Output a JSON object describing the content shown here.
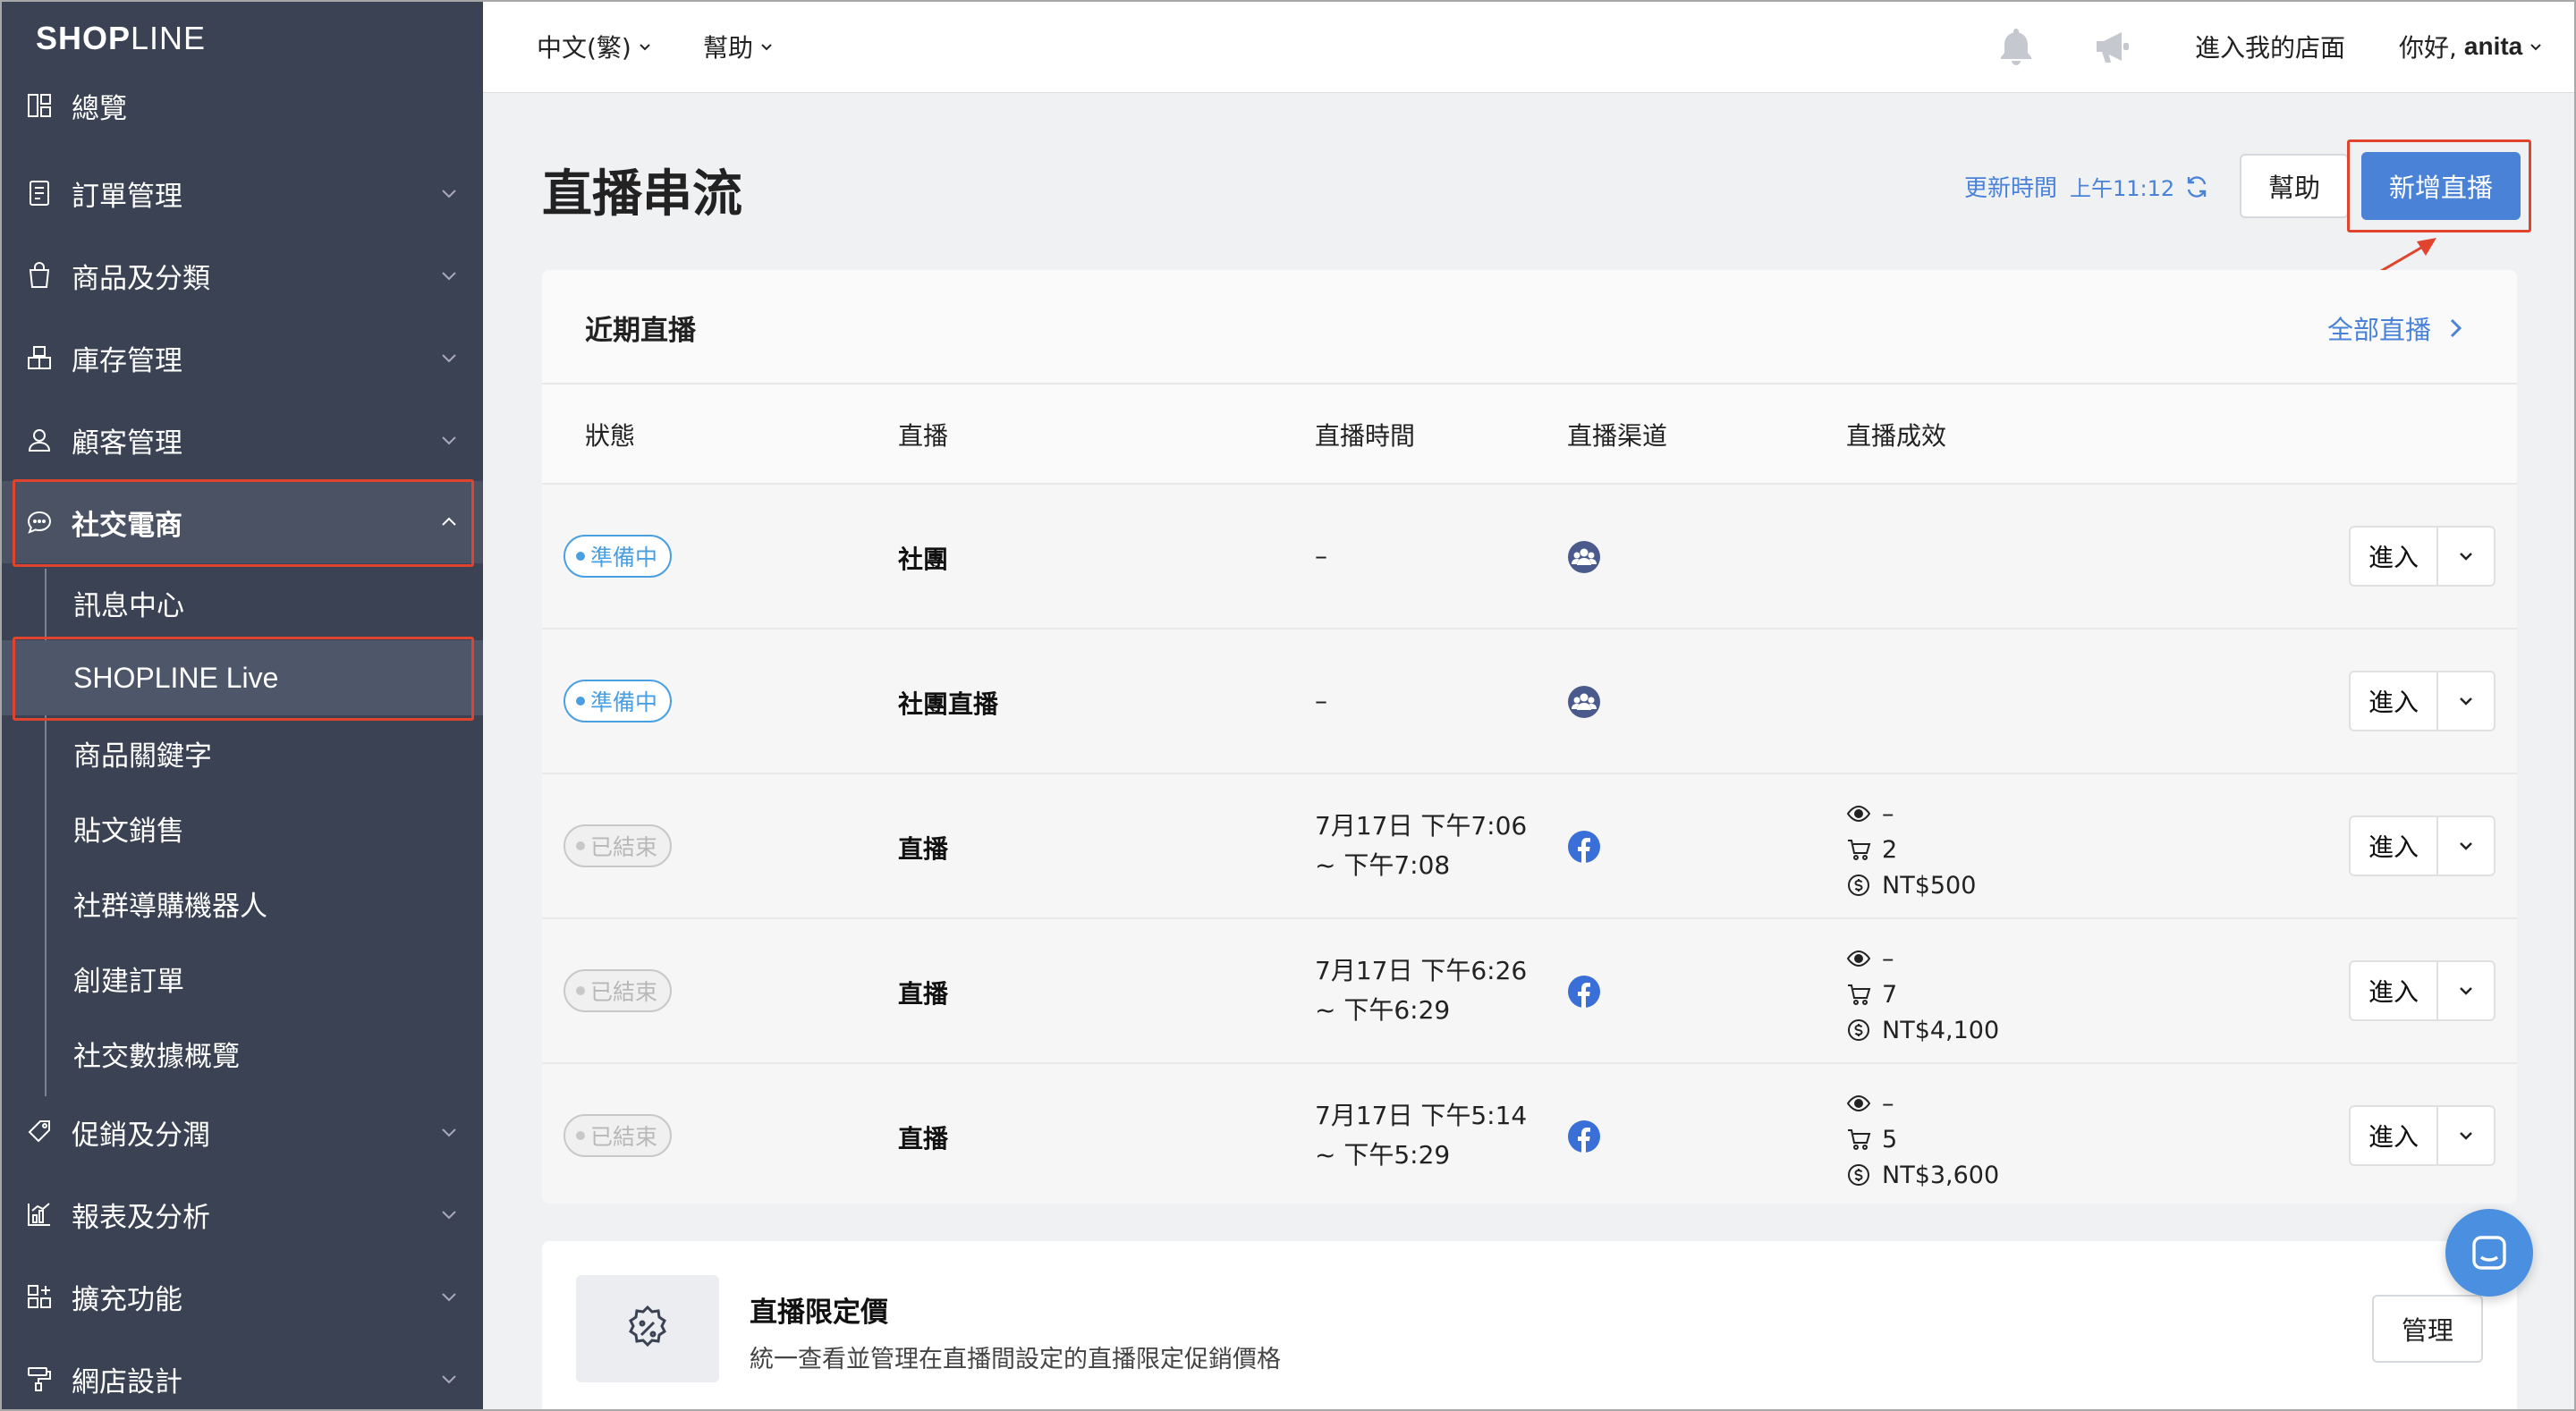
{
  "brand": {
    "logo_text_bold": "SHOP",
    "logo_text_thin": "LINE"
  },
  "sidebar": {
    "items": [
      {
        "label": "總覽",
        "icon": "dashboard-icon"
      },
      {
        "label": "訂單管理",
        "icon": "order-icon"
      },
      {
        "label": "商品及分類",
        "icon": "shopping-bag-icon"
      },
      {
        "label": "庫存管理",
        "icon": "inventory-icon"
      },
      {
        "label": "顧客管理",
        "icon": "user-icon"
      },
      {
        "label": "社交電商",
        "icon": "chat-bubble-icon"
      },
      {
        "label": "促銷及分潤",
        "icon": "tag-icon"
      },
      {
        "label": "報表及分析",
        "icon": "chart-icon"
      },
      {
        "label": "擴充功能",
        "icon": "apps-icon"
      },
      {
        "label": "網店設計",
        "icon": "paint-roller-icon"
      }
    ],
    "sub_items": [
      {
        "label": "訊息中心"
      },
      {
        "label": "SHOPLINE Live"
      },
      {
        "label": "商品關鍵字"
      },
      {
        "label": "貼文銷售"
      },
      {
        "label": "社群導購機器人"
      },
      {
        "label": "創建訂單"
      },
      {
        "label": "社交數據概覽"
      }
    ]
  },
  "topbar": {
    "language": "中文(繁)",
    "help": "幫助",
    "store_link": "進入我的店面",
    "greeting": "你好,",
    "username": "anita"
  },
  "page": {
    "title": "直播串流",
    "update_label": "更新時間",
    "update_time": "上午11:12",
    "help_button": "幫助",
    "new_live_button": "新增直播"
  },
  "recent": {
    "title": "近期直播",
    "all_link": "全部直播",
    "columns": [
      "狀態",
      "直播",
      "直播時間",
      "直播渠道",
      "直播成效"
    ],
    "enter_label": "進入",
    "rows": [
      {
        "status": "準備中",
        "status_type": "prep",
        "name": "社團",
        "time1": "–",
        "time2": "",
        "channel": "group-icon",
        "views": "",
        "orders": "",
        "revenue": ""
      },
      {
        "status": "準備中",
        "status_type": "prep",
        "name": "社團直播",
        "time1": "–",
        "time2": "",
        "channel": "group-icon",
        "views": "",
        "orders": "",
        "revenue": ""
      },
      {
        "status": "已結束",
        "status_type": "ended",
        "name": "直播",
        "time1": "7月17日 下午7:06",
        "time2": "~ 下午7:08",
        "channel": "facebook-icon",
        "views": "–",
        "orders": "2",
        "revenue": "NT$500"
      },
      {
        "status": "已結束",
        "status_type": "ended",
        "name": "直播",
        "time1": "7月17日 下午6:26",
        "time2": "~ 下午6:29",
        "channel": "facebook-icon",
        "views": "–",
        "orders": "7",
        "revenue": "NT$4,100"
      },
      {
        "status": "已結束",
        "status_type": "ended",
        "name": "直播",
        "time1": "7月17日 下午5:14",
        "time2": "~ 下午5:29",
        "channel": "facebook-icon",
        "views": "–",
        "orders": "5",
        "revenue": "NT$3,600"
      }
    ]
  },
  "price_card": {
    "title": "直播限定價",
    "description": "統一查看並管理在直播間設定的直播限定促銷價格",
    "manage_button": "管理"
  },
  "colors": {
    "sidebar_bg": "#3a4253",
    "accent_blue": "#4a82d8",
    "highlight_red": "#e0442f",
    "facebook_blue": "#3b6fd8"
  }
}
